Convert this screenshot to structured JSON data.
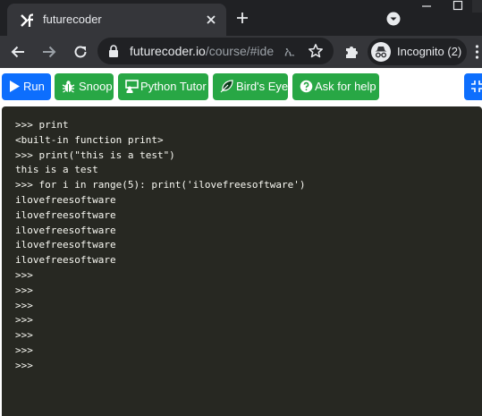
{
  "browser": {
    "tab_title": "futurecoder",
    "url_host": "futurecoder.io",
    "url_path": "/course/#ide",
    "url_trailing_glyph": "ኢ",
    "incognito_label": "Incognito (2)"
  },
  "toolbar": {
    "run_label": "Run",
    "snoop_label": "Snoop",
    "python_tutor_label": "Python Tutor",
    "birds_eye_label": "Bird's Eye",
    "help_label": "Ask for help"
  },
  "console": {
    "lines": [
      ">>> print",
      "<built-in function print>",
      ">>> print(\"this is a test\")",
      "this is a test",
      ">>> for i in range(5): print('ilovefreesoftware')",
      "ilovefreesoftware",
      "ilovefreesoftware",
      "ilovefreesoftware",
      "ilovefreesoftware",
      "ilovefreesoftware",
      ">>>",
      ">>>",
      ">>>",
      ">>>",
      ">>>",
      ">>>",
      ">>>"
    ]
  },
  "icons": {
    "favicon": "futurecoder-logo-icon",
    "close": "close-icon",
    "new_tab": "plus-icon",
    "tab_search": "tab-search-icon",
    "back": "arrow-left-icon",
    "forward": "arrow-right-icon",
    "reload": "reload-icon",
    "lock": "lock-icon",
    "bookmark": "star-icon",
    "extensions": "puzzle-icon",
    "incognito": "incognito-icon",
    "run": "play-icon",
    "snoop": "bug-icon",
    "python_tutor": "chalkboard-teacher-icon",
    "birds_eye": "feather-icon",
    "help": "question-circle-icon",
    "fullscreen": "compress-icon"
  },
  "colors": {
    "chrome_dark": "#202124",
    "chrome_toolbar": "#35363a",
    "primary_button": "#0d6efd",
    "success_button": "#28a745",
    "console_bg": "#272822",
    "console_text": "#f8f8f2"
  }
}
